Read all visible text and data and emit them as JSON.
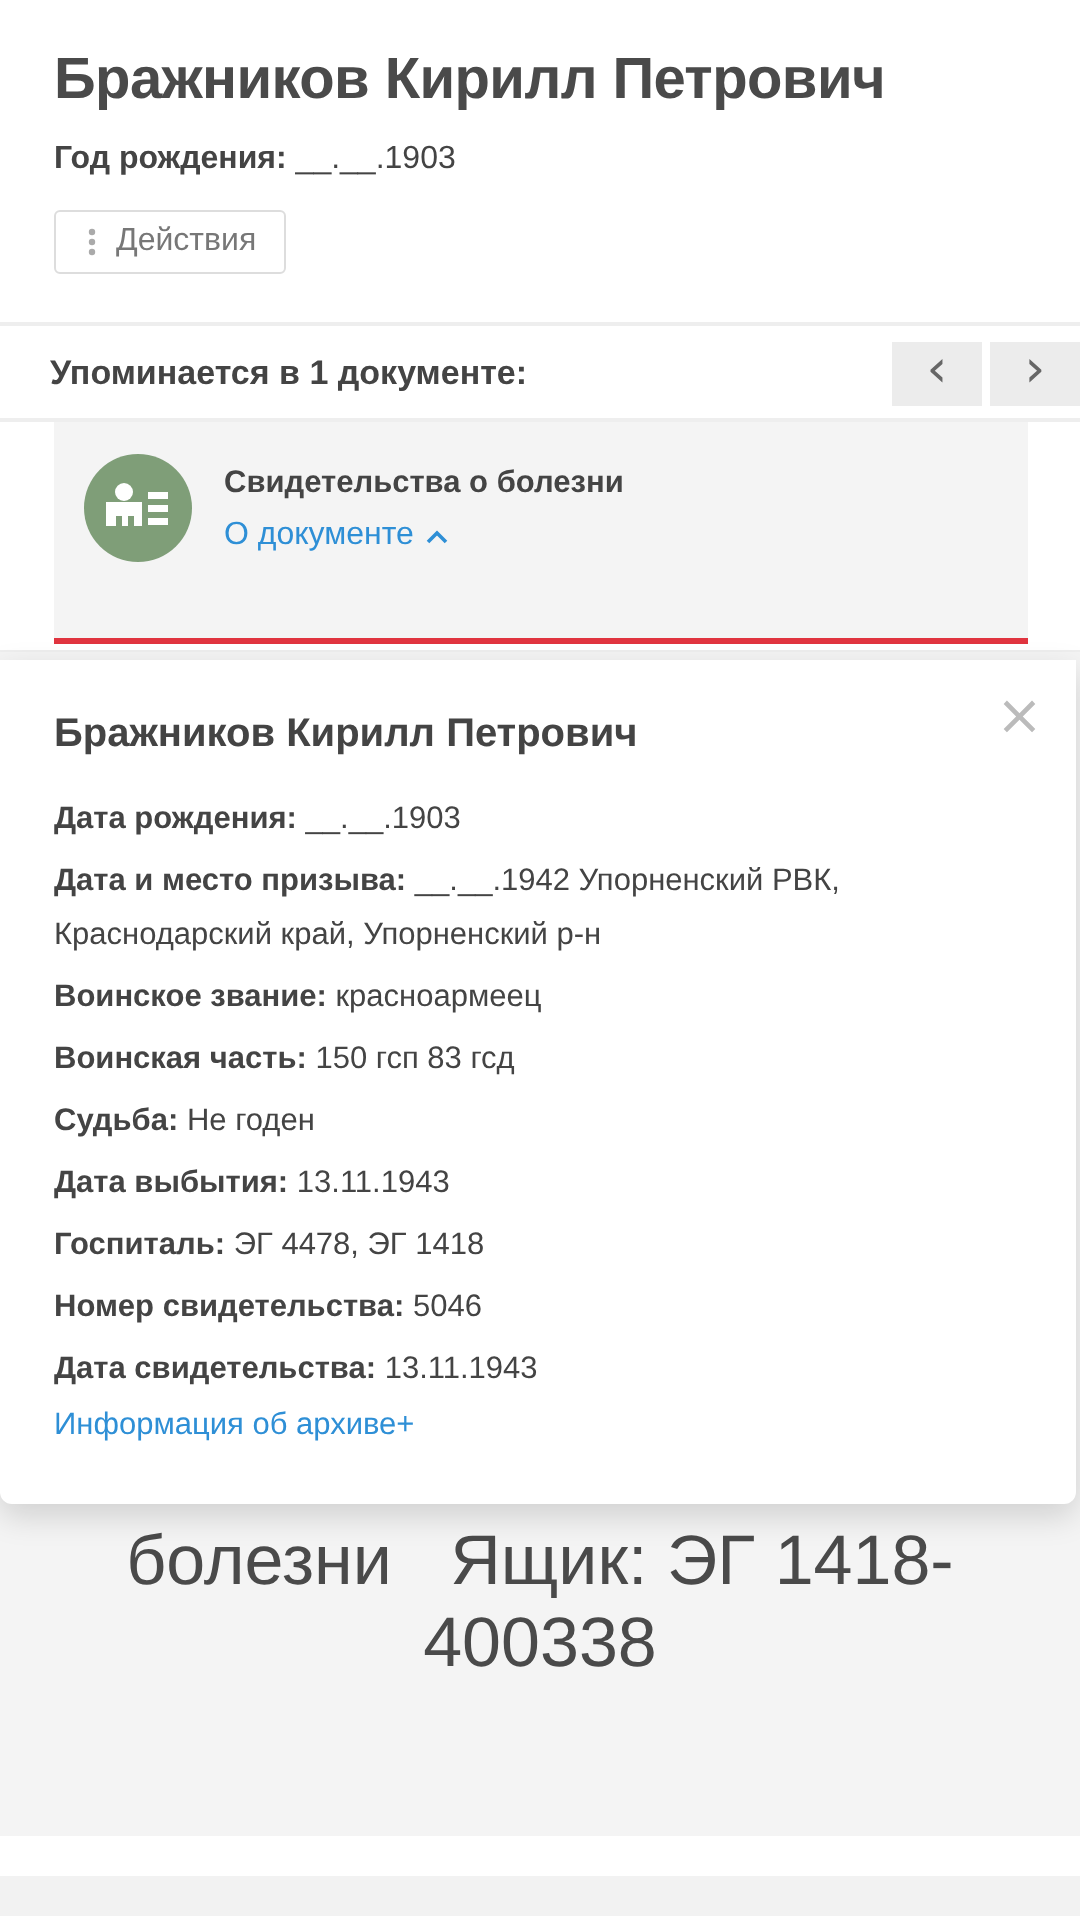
{
  "person": {
    "name": "Бражников Кирилл Петрович",
    "birth": "**Год рождения:** __.__.1903"
  },
  "actions_button": {
    "label": "Действия"
  },
  "mentions": {
    "title": "Упоминается в 1 документе:",
    "prev": "‹",
    "next": "›"
  },
  "document": {
    "title": "Свидетельства о болезни",
    "link": "О документе",
    "expanded": true
  },
  "popup": {
    "name": "Бражников Кирилл Петрович",
    "close": "×",
    "fields": [
      "**Дата рождения:** __.__.1903",
      "**Дата и место призыва:** __.__.1942 Упорненский РВК, Краснодарский край, Упорненский р-н",
      "**Воинское звание:** красноармеец",
      "**Воинская часть:** 150 гсп 83 гсд",
      "**Судьба:** Не годен",
      "**Дата выбытия:** 13.11.1943",
      "**Госпиталь:** ЭГ 4478, ЭГ 1418",
      "**Номер свидетельства:** 5046",
      "**Дата свидетельства:** 13.11.1943"
    ],
    "archive_link": "Информация об архиве+"
  },
  "background_caption": [
    "болезни   Ящик: ЭГ 1418-",
    "400338"
  ]
}
